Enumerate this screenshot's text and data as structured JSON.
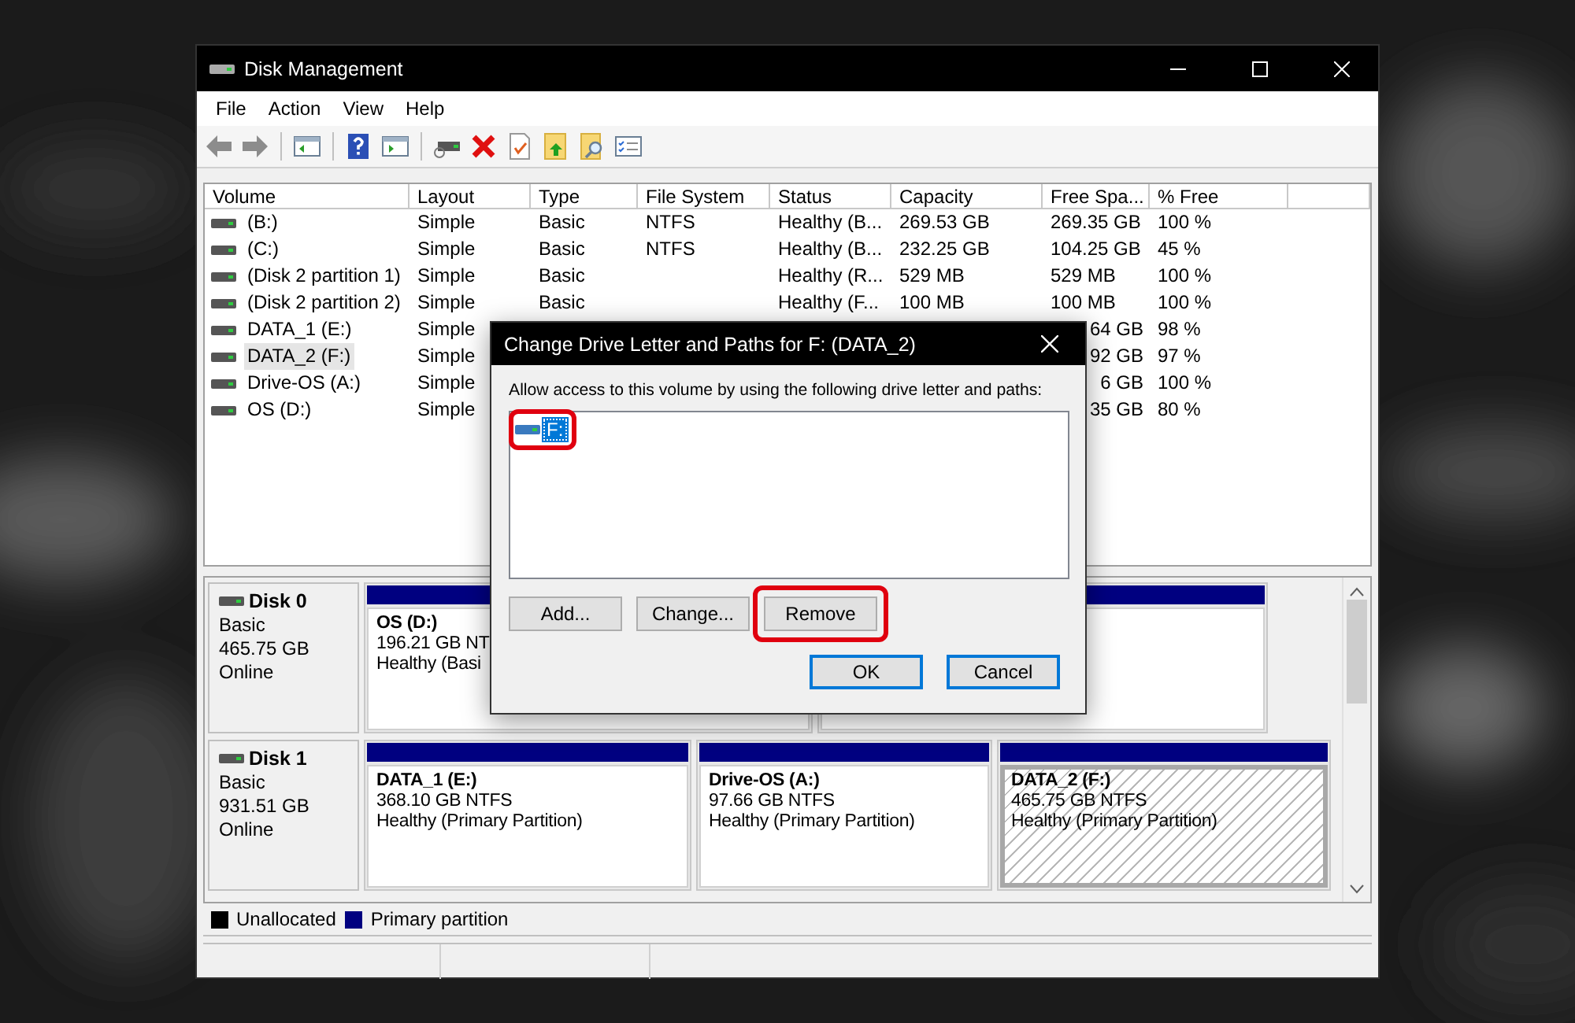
{
  "window": {
    "title": "Disk Management"
  },
  "menu": [
    "File",
    "Action",
    "View",
    "Help"
  ],
  "table": {
    "columns": [
      "Volume",
      "Layout",
      "Type",
      "File System",
      "Status",
      "Capacity",
      "Free Spa...",
      "% Free"
    ],
    "rows": [
      {
        "volume": "(B:)",
        "layout": "Simple",
        "type": "Basic",
        "file_system": "NTFS",
        "status": "Healthy (B...",
        "capacity": "269.53 GB",
        "free_space": "269.35 GB",
        "percent_free": "100 %",
        "selected": false,
        "covered": false
      },
      {
        "volume": "(C:)",
        "layout": "Simple",
        "type": "Basic",
        "file_system": "NTFS",
        "status": "Healthy (B...",
        "capacity": "232.25 GB",
        "free_space": "104.25 GB",
        "percent_free": "45 %",
        "selected": false,
        "covered": false
      },
      {
        "volume": "(Disk 2 partition 1)",
        "layout": "Simple",
        "type": "Basic",
        "status": "Healthy (R...",
        "capacity": "529 MB",
        "free_space": "529 MB",
        "percent_free": "100 %",
        "selected": false,
        "covered": false
      },
      {
        "volume": "(Disk 2 partition 2)",
        "layout": "Simple",
        "type": "Basic",
        "status": "Healthy (F...",
        "capacity": "100 MB",
        "free_space": "100 MB",
        "percent_free": "100 %",
        "selected": false,
        "covered": false
      },
      {
        "volume": "DATA_1 (E:)",
        "layout": "Simple",
        "free_space": "64 GB",
        "percent_free": "98 %",
        "selected": false,
        "covered": true
      },
      {
        "volume": "DATA_2 (F:)",
        "layout": "Simple",
        "free_space": "92 GB",
        "percent_free": "97 %",
        "selected": true,
        "covered": true
      },
      {
        "volume": "Drive-OS (A:)",
        "layout": "Simple",
        "free_space": "6 GB",
        "percent_free": "100 %",
        "selected": false,
        "covered": true
      },
      {
        "volume": "OS (D:)",
        "layout": "Simple",
        "free_space": "35 GB",
        "percent_free": "80 %",
        "selected": false,
        "covered": true
      }
    ]
  },
  "disks": [
    {
      "name": "Disk 0",
      "type": "Basic",
      "size": "465.75 GB",
      "state": "Online",
      "partitions": [
        {
          "title": "OS  (D:)",
          "size": "196.21 GB NT",
          "status": "Healthy (Basi",
          "selected": false
        },
        {
          "selected": false
        }
      ]
    },
    {
      "name": "Disk 1",
      "type": "Basic",
      "size": "931.51 GB",
      "state": "Online",
      "partitions": [
        {
          "title": "DATA_1  (E:)",
          "size": "368.10 GB NTFS",
          "status": "Healthy (Primary Partition)",
          "selected": false
        },
        {
          "title": "Drive-OS  (A:)",
          "size": "97.66 GB NTFS",
          "status": "Healthy (Primary Partition)",
          "selected": false
        },
        {
          "title": "DATA_2  (F:)",
          "size": "465.75 GB NTFS",
          "status": "Healthy (Primary Partition)",
          "selected": true
        }
      ]
    }
  ],
  "legend": [
    {
      "label": "Unallocated",
      "color": "#000000"
    },
    {
      "label": "Primary partition",
      "color": "#000080"
    }
  ],
  "dialog": {
    "title": "Change Drive Letter and Paths for F: (DATA_2)",
    "label": "Allow access to this volume by using the following drive letter and paths:",
    "paths": [
      {
        "text": "F:",
        "selected": true,
        "highlighted": true
      }
    ],
    "buttons": [
      {
        "label": "Add...",
        "kind": "action",
        "highlighted": false
      },
      {
        "label": "Change...",
        "kind": "action",
        "highlighted": false
      },
      {
        "label": "Remove",
        "kind": "action",
        "highlighted": true
      },
      {
        "label": "OK",
        "kind": "confirm",
        "highlighted": false
      },
      {
        "label": "Cancel",
        "kind": "confirm",
        "highlighted": false
      }
    ]
  }
}
